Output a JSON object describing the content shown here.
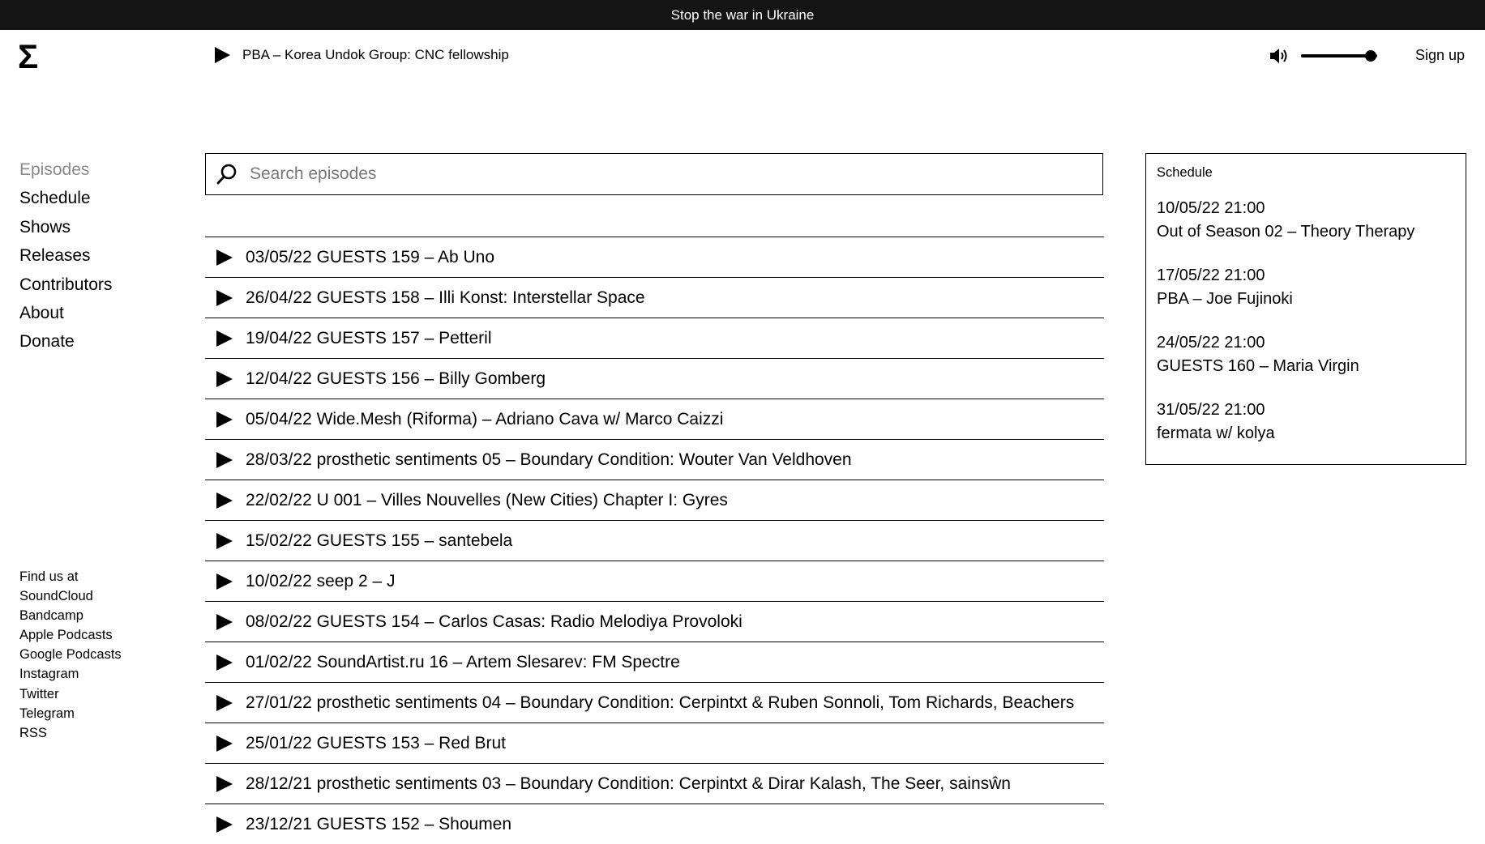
{
  "banner": {
    "text": "Stop the war in Ukraine"
  },
  "logo": {
    "glyph": "Σ"
  },
  "player": {
    "now_playing": "PBA – Korea Undok Group: CNC fellowship",
    "volume_level": 0.92
  },
  "header": {
    "signup_label": "Sign up"
  },
  "nav": {
    "items": [
      {
        "label": "Episodes"
      },
      {
        "label": "Schedule"
      },
      {
        "label": "Shows"
      },
      {
        "label": "Releases"
      },
      {
        "label": "Contributors"
      },
      {
        "label": "About"
      },
      {
        "label": "Donate"
      }
    ]
  },
  "findus": {
    "title": "Find us at",
    "links": [
      "SoundCloud",
      "Bandcamp",
      "Apple Podcasts",
      "Google Podcasts",
      "Instagram",
      "Twitter",
      "Telegram",
      "RSS"
    ]
  },
  "search": {
    "placeholder": "Search episodes",
    "value": ""
  },
  "episodes": [
    "03/05/22 GUESTS 159 – Ab Uno",
    "26/04/22 GUESTS 158 – Illi Konst: Interstellar Space",
    "19/04/22 GUESTS 157 – Petteril",
    "12/04/22 GUESTS 156 – Billy Gomberg",
    "05/04/22 Wide.Mesh (Riforma) – Adriano Cava w/ Marco Caizzi",
    "28/03/22 prosthetic sentiments 05 – Boundary Condition: Wouter Van Veldhoven",
    "22/02/22 U 001 – Villes Nouvelles (New Cities) Chapter I: Gyres",
    "15/02/22 GUESTS 155 – santebela",
    "10/02/22 seep 2 – J",
    "08/02/22 GUESTS 154 – Carlos Casas: Radio Melodiya Provoloki",
    "01/02/22 SoundArtist.ru 16 – Artem Slesarev: FM Spectre",
    "27/01/22 prosthetic sentiments 04 – Boundary Condition: Cerpintxt & Ruben Sonnoli, Tom Richards, Beachers",
    "25/01/22 GUESTS 153 – Red Brut",
    "28/12/21 prosthetic sentiments 03 – Boundary Condition: Cerpintxt & Dirar Kalash, The Seer, sainsŵn",
    "23/12/21 GUESTS 152 – Shoumen"
  ],
  "schedule": {
    "title": "Schedule",
    "items": [
      {
        "datetime": "10/05/22 21:00",
        "title": "Out of Season 02 – Theory Therapy"
      },
      {
        "datetime": "17/05/22 21:00",
        "title": "PBA – Joe Fujinoki"
      },
      {
        "datetime": "24/05/22 21:00",
        "title": "GUESTS 160 – Maria Virgin"
      },
      {
        "datetime": "31/05/22 21:00",
        "title": "fermata w/ kolya"
      }
    ]
  }
}
